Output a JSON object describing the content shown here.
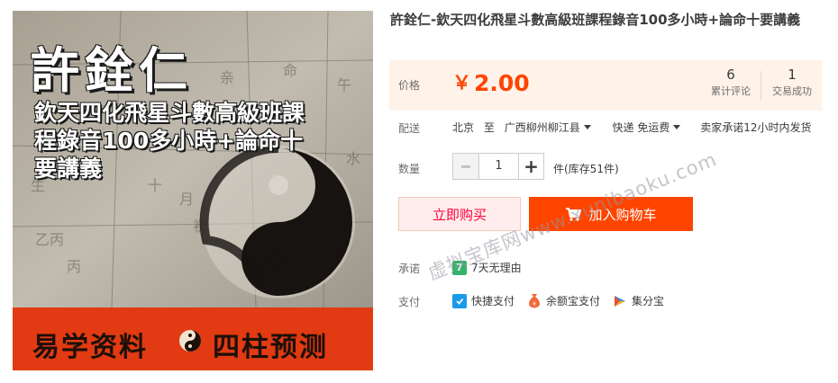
{
  "image": {
    "hero_name": "許銓仁",
    "hero_subtitle": "欽天四化飛星斗數高級班課程錄音100多小時+論命十要講義",
    "banner_left": "易学资料",
    "banner_right": "四柱预测"
  },
  "product": {
    "title": "許銓仁-欽天四化飛星斗數高級班課程錄音100多小時+論命十要講義"
  },
  "price": {
    "label": "价格",
    "currency": "￥",
    "value": "2.00",
    "reviews_count": "6",
    "reviews_label": "累计评论",
    "sold_count": "1",
    "sold_label": "交易成功"
  },
  "shipping": {
    "label": "配送",
    "from": "北京",
    "to_word": "至",
    "destination": "广西柳州柳江县",
    "method": "快递 免运费",
    "promise": "卖家承诺12小时内发货"
  },
  "quantity": {
    "label": "数量",
    "value": "1",
    "stock": "件(库存51件)"
  },
  "actions": {
    "buy_now": "立即购买",
    "add_to_cart": "加入购物车"
  },
  "promise": {
    "label": "承诺",
    "badge": "7",
    "text": "7天无理由"
  },
  "payment": {
    "label": "支付",
    "methods": [
      "快捷支付",
      "余额宝支付",
      "集分宝"
    ]
  },
  "watermark": "虚拟宝库网www.xunibaoku.com",
  "colors": {
    "accent": "#ff4400",
    "price_bg": "#fff2e8",
    "banner": "#e23a12"
  }
}
